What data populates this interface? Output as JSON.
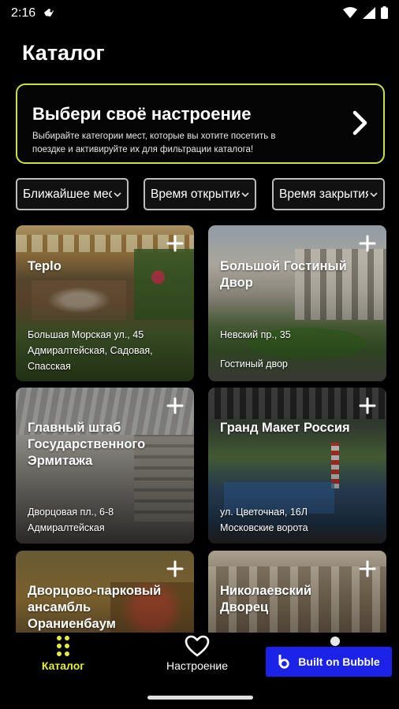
{
  "status_bar": {
    "time": "2:16"
  },
  "page": {
    "title": "Каталог"
  },
  "mood_banner": {
    "title": "Выбери своё настроение",
    "subtitle": "Выбирайте категории мест, которые вы хотите посетить в поездке и активируйте их для фильтрации каталога!"
  },
  "filters": [
    {
      "label": "Ближайшее место"
    },
    {
      "label": "Время открытия"
    },
    {
      "label": "Время закрытия"
    }
  ],
  "cards": [
    {
      "name": "Teplo",
      "address": "Большая Морская ул., 45",
      "metro": "Адмиралтейская, Садовая, Спасская"
    },
    {
      "name": "Большой Гостиный Двор",
      "address": "Невский пр., 35",
      "metro": "Гостиный двор"
    },
    {
      "name": "Главный штаб Государственного Эрмитажа",
      "address": "Дворцовая пл., 6-8",
      "metro": "Адмиралтейская"
    },
    {
      "name": "Гранд Макет Россия",
      "address": "ул. Цветочная, 16Л",
      "metro": "Московские ворота"
    },
    {
      "name": "Дворцово-парковый ансамбль Ораниенбаум",
      "address": "",
      "metro": ""
    },
    {
      "name": "Николаевский Дворец",
      "address": "",
      "metro": ""
    }
  ],
  "bottom_nav": {
    "catalog": "Каталог",
    "mood": "Настроение",
    "bubble": "Built on Bubble"
  },
  "colors": {
    "accent": "#c9e33a",
    "nav_active": "#e4ec3b",
    "bubble": "#1b23e8"
  }
}
